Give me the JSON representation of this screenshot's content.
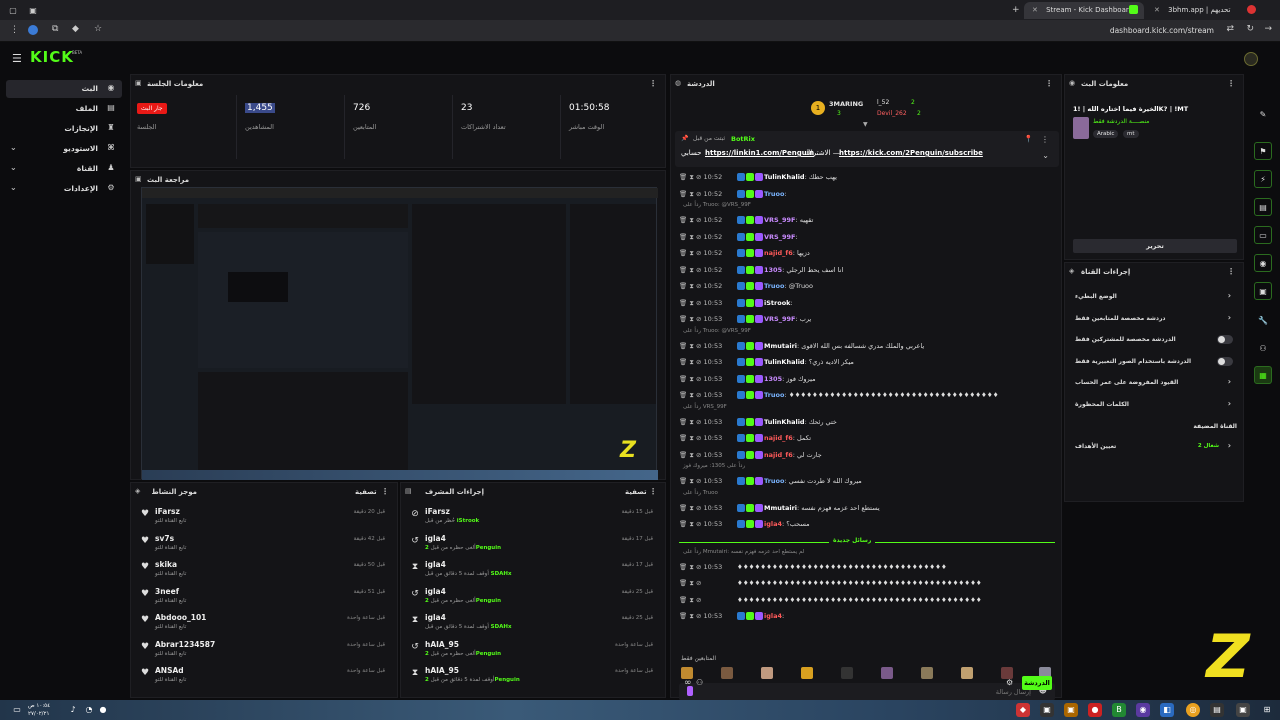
{
  "browser": {
    "tabs": [
      {
        "title": "Stream - Kick Dashboard",
        "active": true
      },
      {
        "title": "3bhm.app | تحديهم",
        "active": false
      }
    ],
    "url": "dashboard.kick.com/stream"
  },
  "kick": {
    "logo": "KICK",
    "logo_sup": "BETA"
  },
  "nav": {
    "items": [
      {
        "label": "البث",
        "active": true,
        "icon": "broadcast-icon"
      },
      {
        "label": "الملف",
        "icon": "profile-icon"
      },
      {
        "label": "الإنجازات",
        "icon": "trophy-icon"
      },
      {
        "label": "الاستوديو",
        "icon": "studio-icon",
        "expandable": true
      },
      {
        "label": "القناة",
        "icon": "channel-icon",
        "expandable": true
      },
      {
        "label": "الإعدادات",
        "icon": "settings-icon",
        "expandable": true
      }
    ]
  },
  "session": {
    "title": "معلومات الجلسة",
    "live_badge": "جار البث",
    "live_label": "الجلسة",
    "stats": [
      {
        "value": "1,455",
        "label": "المشاهدين"
      },
      {
        "value": "726",
        "label": "المتابعين"
      },
      {
        "value": "23",
        "label": "تعداد الاشتراكات"
      },
      {
        "value": "01:50:58",
        "label": "الوقت مباشر"
      }
    ]
  },
  "preview": {
    "title": "مراجعة البث"
  },
  "activity": {
    "title": "موجز النشاط",
    "filter": "تصفية",
    "items": [
      {
        "name": "iFarsz",
        "sub": "تابع القناة للتو",
        "time": "قبل 20 دقيقة"
      },
      {
        "name": "sv7s",
        "sub": "تابع القناة للتو",
        "time": "قبل 42 دقيقة"
      },
      {
        "name": "skika",
        "sub": "تابع القناة للتو",
        "time": "قبل 50 دقيقة"
      },
      {
        "name": "3neef",
        "sub": "تابع القناة للتو",
        "time": "قبل 51 دقيقة"
      },
      {
        "name": "Abdooo_101",
        "sub": "تابع القناة للتو",
        "time": "قبل ساعة واحدة"
      },
      {
        "name": "Abrar1234587",
        "sub": "تابع القناة للتو",
        "time": "قبل ساعة واحدة"
      },
      {
        "name": "ANSAd",
        "sub": "تابع القناة للتو",
        "time": "قبل ساعة واحدة"
      }
    ]
  },
  "modactions": {
    "title": "إجراءات المشرف",
    "filter": "تصفية",
    "items": [
      {
        "name": "iFarsz",
        "sub": "حُظر من قبل",
        "by": "iStrook",
        "time": "قبل 15 دقيقة",
        "icon": "ban-icon"
      },
      {
        "name": "igla4",
        "sub": "ألغى حظره من قبل",
        "by": "2Penguin",
        "time": "قبل 17 دقيقة",
        "icon": "undo-icon"
      },
      {
        "name": "igla4",
        "sub": "أوقف لمدة 5 دقائق من قبل",
        "by": "SDAHx",
        "time": "قبل 17 دقيقة",
        "icon": "hourglass-icon"
      },
      {
        "name": "igla4",
        "sub": "ألغى حظره من قبل",
        "by": "2Penguin",
        "time": "قبل 25 دقيقة",
        "icon": "undo-icon"
      },
      {
        "name": "igla4",
        "sub": "أوقف لمدة 5 دقائق من قبل",
        "by": "SDAHx",
        "time": "قبل 25 دقيقة",
        "icon": "hourglass-icon"
      },
      {
        "name": "hAIA_95",
        "sub": "ألغى حظره من قبل",
        "by": "2Penguin",
        "time": "قبل ساعة واحدة",
        "icon": "undo-icon"
      },
      {
        "name": "hAIA_95",
        "sub": "أوقف لمدة 5 دقائق من قبل",
        "by": "2Penguin",
        "time": "قبل ساعة واحدة",
        "icon": "hourglass-icon"
      }
    ]
  },
  "chat": {
    "title": "الدردشة",
    "top_gifters": [
      {
        "name": "3MARING",
        "count": "3"
      },
      {
        "name": "l_52",
        "count": "2"
      },
      {
        "name": "Devil_262",
        "count": "2"
      }
    ],
    "pinned_by": "ثبتت من قبل",
    "pinned_user": "BotRix",
    "pinned_text_a": "حسابي",
    "pinned_link_a": "https://linkin1.com/Penguin",
    "pinned_text_b": "الاشتراك —",
    "pinned_link_b": "https://kick.com/2Penguin/subscribe",
    "messages": [
      {
        "time": "10:52",
        "user": "TulinKhalid",
        "color": "#ffffff",
        "text": "يهب حطك"
      },
      {
        "time": "10:52",
        "user": "Truoo",
        "color": "#7ab4ff",
        "text": ""
      },
      {
        "reply": "رداً على Truoo: @VRS_99F"
      },
      {
        "time": "10:52",
        "user": "VRS_99F",
        "color": "#c98bff",
        "text": "تقهيه"
      },
      {
        "time": "10:52",
        "user": "VRS_99F",
        "color": "#c98bff",
        "text": ""
      },
      {
        "time": "10:52",
        "user": "najid_f6",
        "color": "#ff5a5a",
        "text": "دزيها"
      },
      {
        "time": "10:52",
        "user": "1305",
        "color": "#c98bff",
        "text": "انا اسف يحط الرجلي"
      },
      {
        "time": "10:52",
        "user": "Truoo",
        "color": "#7ab4ff",
        "text": "@Truoo"
      },
      {
        "time": "10:53",
        "user": "iStrook",
        "color": "#ffffff",
        "text": ""
      },
      {
        "time": "10:53",
        "user": "VRS_99F",
        "color": "#c98bff",
        "text": "يرب"
      },
      {
        "reply": "رداً على Truoo: @VRS_99F"
      },
      {
        "time": "10:53",
        "user": "Mmutairi",
        "color": "#ffffff",
        "text": "ياعربي والملك مدري شسالفه بس الله الاقوى"
      },
      {
        "time": "10:53",
        "user": "TulinKhalid",
        "color": "#ffffff",
        "text": "ميكر الاديه ذري؟"
      },
      {
        "time": "10:53",
        "user": "1305",
        "color": "#c98bff",
        "text": "ميروك فوز"
      },
      {
        "time": "10:53",
        "user": "Truoo",
        "color": "#7ab4ff",
        "text": "♦♦♦♦♦♦♦♦♦♦♦♦♦♦♦♦♦♦♦♦♦♦♦♦♦♦♦♦♦♦♦♦♦♦♦♦"
      },
      {
        "reply": "رداً على VRS_99F"
      },
      {
        "time": "10:53",
        "user": "TulinKhalid",
        "color": "#ffffff",
        "text": "ختي رئحك"
      },
      {
        "time": "10:53",
        "user": "najid_f6",
        "color": "#ff5a5a",
        "text": "تكمل"
      },
      {
        "time": "10:53",
        "user": "najid_f6",
        "color": "#ff5a5a",
        "text": "جارت لي"
      },
      {
        "reply": "رداً على 1305: ميروك فوز"
      },
      {
        "time": "10:53",
        "user": "Truoo",
        "color": "#7ab4ff",
        "text": "ميروك الله لا طردت نفسي"
      },
      {
        "reply": "رداً على Truoo"
      },
      {
        "time": "10:53",
        "user": "Mmutairi",
        "color": "#ffffff",
        "text": "يستطع احد عزمه فهزم نفسه"
      },
      {
        "time": "10:53",
        "user": "igla4",
        "color": "#ff5a5a",
        "text": "مسحب؟"
      }
    ],
    "new_messages": "رسائل جديدة",
    "after": [
      {
        "reply": "رداً على Mmutairi: لم يستطع احد عزمه فهزم نفسه"
      },
      {
        "time": "10:53",
        "user": "",
        "color": "#ffffff",
        "text": "♦♦♦♦♦♦♦♦♦♦♦♦♦♦♦♦♦♦♦♦♦♦♦♦♦♦♦♦♦♦♦♦♦♦♦♦"
      },
      {
        "time": "",
        "user": "",
        "color": "#ffffff",
        "text": "♦♦♦♦♦♦♦♦♦♦♦♦♦♦♦♦♦♦♦♦♦♦♦♦♦♦♦♦♦♦♦♦♦♦♦♦♦♦♦♦♦♦"
      },
      {
        "time": "",
        "user": "",
        "color": "#ffffff",
        "text": "♦♦♦♦♦♦♦♦♦♦♦♦♦♦♦♦♦♦♦♦♦♦♦♦♦♦♦♦♦♦♦♦♦♦♦♦♦♦♦♦♦♦"
      },
      {
        "time": "10:53",
        "user": "igla4",
        "color": "#ff5a5a",
        "text": ""
      }
    ],
    "followers_only": "المتابعين فقط",
    "placeholder": "إرسال رسالة",
    "send": "الدردشة"
  },
  "streaminfo": {
    "title": "معلومات البث",
    "stream_title": "الخيرة فيما اختاره الله | !1K? | !MT",
    "category": "منصــــة الدردشة فقط",
    "tags": [
      "Arabic",
      "mt"
    ],
    "edit": "تحرير"
  },
  "channelactions": {
    "title": "إجراءات القناة",
    "items": [
      {
        "label": "الوضع البطيء",
        "type": "chevron"
      },
      {
        "label": "دردشة مخصصة للمتابعين فقط",
        "type": "chevron"
      },
      {
        "label": "الدردشة مخصصة للمشتركين فقط",
        "type": "toggle"
      },
      {
        "label": "الدردشة باستخدام الصور التعبيرية فقط",
        "type": "toggle"
      },
      {
        "label": "القيود المفروضة على عمر الحساب",
        "type": "chevron"
      },
      {
        "label": "الكلمات المحظورة",
        "type": "chevron"
      }
    ],
    "host_label": "القناة المضيفة",
    "host_item": "تعيين الأهداف",
    "host_status": "شغال 2"
  },
  "taskbar": {
    "time": "١٠:٥٤ ص",
    "date": "٢٧/٠٢/٢١"
  },
  "colors": {
    "accent": "#53fc18",
    "live": "#e91916",
    "bg": "#0c0c0e",
    "panel": "#141417"
  }
}
